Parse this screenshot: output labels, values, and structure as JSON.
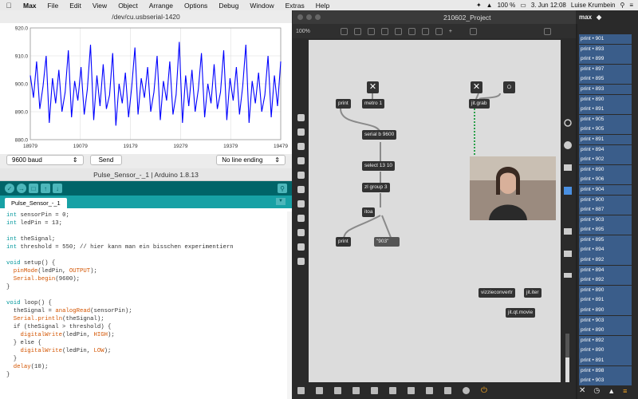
{
  "menubar": {
    "app": "Max",
    "items": [
      "File",
      "Edit",
      "View",
      "Object",
      "Arrange",
      "Options",
      "Debug",
      "Window",
      "Extras",
      "Help"
    ],
    "battery": "100 %",
    "datetime": "3. Jun  12:08",
    "user": "Luise Krumbein"
  },
  "plotter": {
    "title": "/dev/cu.usbserial-1420",
    "baud": "9600 baud",
    "send": "Send",
    "line_ending": "No line ending"
  },
  "chart_data": {
    "type": "line",
    "title": "",
    "xlabel": "",
    "ylabel": "",
    "x_ticks": [
      "18979",
      "19079",
      "19179",
      "19279",
      "19379",
      "19479"
    ],
    "y_ticks": [
      "920.0",
      "910.0",
      "900.0",
      "890.0",
      "880.0"
    ],
    "xlim": [
      18979,
      19479
    ],
    "ylim": [
      880,
      920
    ],
    "grid": true,
    "color": "#0000ff",
    "series": [
      {
        "values": [
          903,
          895,
          908,
          891,
          899,
          910,
          886,
          902,
          893,
          905,
          890,
          897,
          912,
          888,
          901,
          894,
          906,
          889,
          898,
          914,
          887,
          903,
          892,
          907,
          891,
          896,
          911,
          885,
          900,
          893,
          904,
          888,
          899,
          913,
          889,
          902,
          895,
          906,
          890,
          897,
          910,
          887,
          901,
          894,
          908,
          889,
          896,
          915,
          886,
          903,
          892,
          905,
          890,
          898,
          911,
          888,
          900,
          893,
          907,
          891,
          897,
          912,
          887,
          902,
          894,
          906,
          889,
          899,
          914,
          886,
          901,
          893,
          904,
          890,
          896,
          910,
          888,
          903,
          892,
          908
        ]
      }
    ]
  },
  "arduino": {
    "title": "Pulse_Sensor_-_1 | Arduino 1.8.13",
    "tab": "Pulse_Sensor_-_1",
    "code": [
      "int sensorPin = 0;",
      "int ledPin = 13;",
      "",
      "int theSignal;",
      "int threshold = 550; // hier kann man ein bisschen experimentiern",
      "",
      "void setup() {",
      "  pinMode(ledPin, OUTPUT);",
      "  Serial.begin(9600);",
      "}",
      "",
      "void loop() {",
      "  theSignal = analogRead(sensorPin);",
      "  Serial.println(theSignal);",
      "  if (theSignal > threshold) {",
      "    digitalWrite(ledPin, HIGH);",
      "  } else {",
      "    digitalWrite(ledPin, LOW);",
      "  }",
      "  delay(10);",
      "}"
    ]
  },
  "patcher": {
    "title": "210602_Project",
    "zoom": "100%",
    "objects": {
      "print1": "print",
      "metro": "metro 1",
      "serial": "serial b 9600",
      "select": "select 13 10",
      "zlgroup": "zl group 3",
      "itoa": "itoa",
      "print2": "print",
      "msg": "\"903\"",
      "jitgrab": "jit.grab",
      "vizzie": "vizzieconvertr",
      "jititer": "jit.iter",
      "jitqt": "jit.qt.movie"
    }
  },
  "console": {
    "title": "max",
    "rows": [
      "print • 901",
      "print • 893",
      "print • 899",
      "print • 897",
      "print • 895",
      "print • 893",
      "print • 890",
      "print • 891",
      "print • 905",
      "print • 905",
      "print • 891",
      "print • 894",
      "print • 902",
      "print • 890",
      "print • 906",
      "print • 904",
      "print • 900",
      "print • 887",
      "print • 903",
      "print • 895",
      "print • 895",
      "print • 894",
      "print • 892",
      "print • 894",
      "print • 892",
      "print • 890",
      "print • 891",
      "print • 890",
      "print • 903",
      "print • 890",
      "print • 892",
      "print • 890",
      "print • 891",
      "print • 898",
      "print • 903"
    ]
  }
}
